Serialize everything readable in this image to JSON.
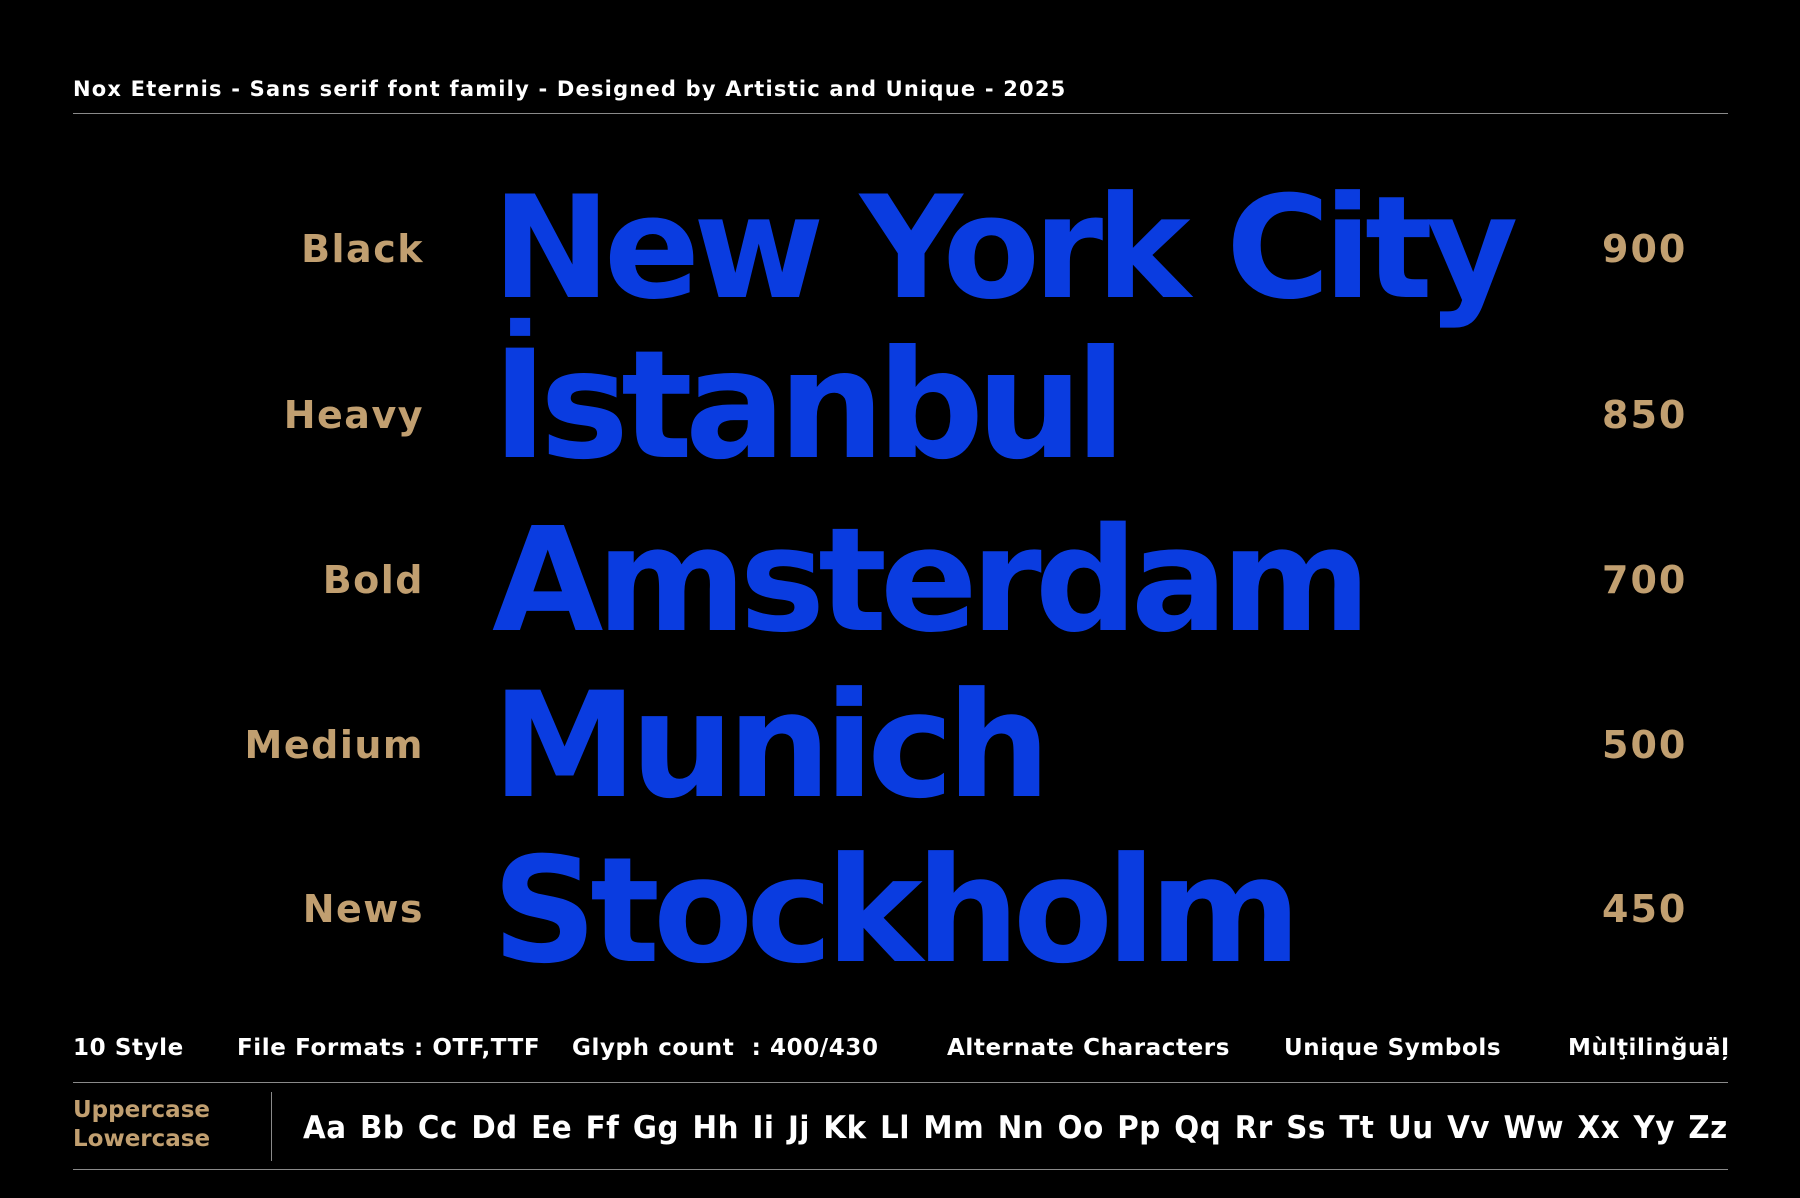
{
  "header": {
    "title": "Nox Eternis - Sans serif font family - Designed by Artistic and Unique - 2025"
  },
  "colors": {
    "background": "#000000",
    "sample_blue": "#0a3ce0",
    "label_tan": "#c19f70",
    "text_white": "#ffffff",
    "rule_gray": "#8a8a8a"
  },
  "weights": [
    {
      "style": "Black",
      "sample": "New York City",
      "value": "900"
    },
    {
      "style": "Heavy",
      "sample": "İstanbul",
      "value": "850"
    },
    {
      "style": "Bold",
      "sample": "Amsterdam",
      "value": "700"
    },
    {
      "style": "Medium",
      "sample": "Munich",
      "value": "500"
    },
    {
      "style": "News",
      "sample": "Stockholm",
      "value": "450"
    }
  ],
  "features": {
    "styles": "10 Style",
    "formats": "File Formats : OTF,TTF",
    "glyphs": "Glyph count  : 400/430",
    "alternates": "Alternate Characters",
    "symbols": "Unique Symbols",
    "multilingual": "Mùlţilinğuäļ"
  },
  "character_set": {
    "uppercase_label": "Uppercase",
    "lowercase_label": "Lowercase",
    "alphabet": "Aa Bb Cc Dd Ee Ff Gg Hh Ii Jj Kk Ll Mm Nn Oo Pp Qq Rr Ss Tt Uu Vv Ww Xx Yy Zz"
  }
}
